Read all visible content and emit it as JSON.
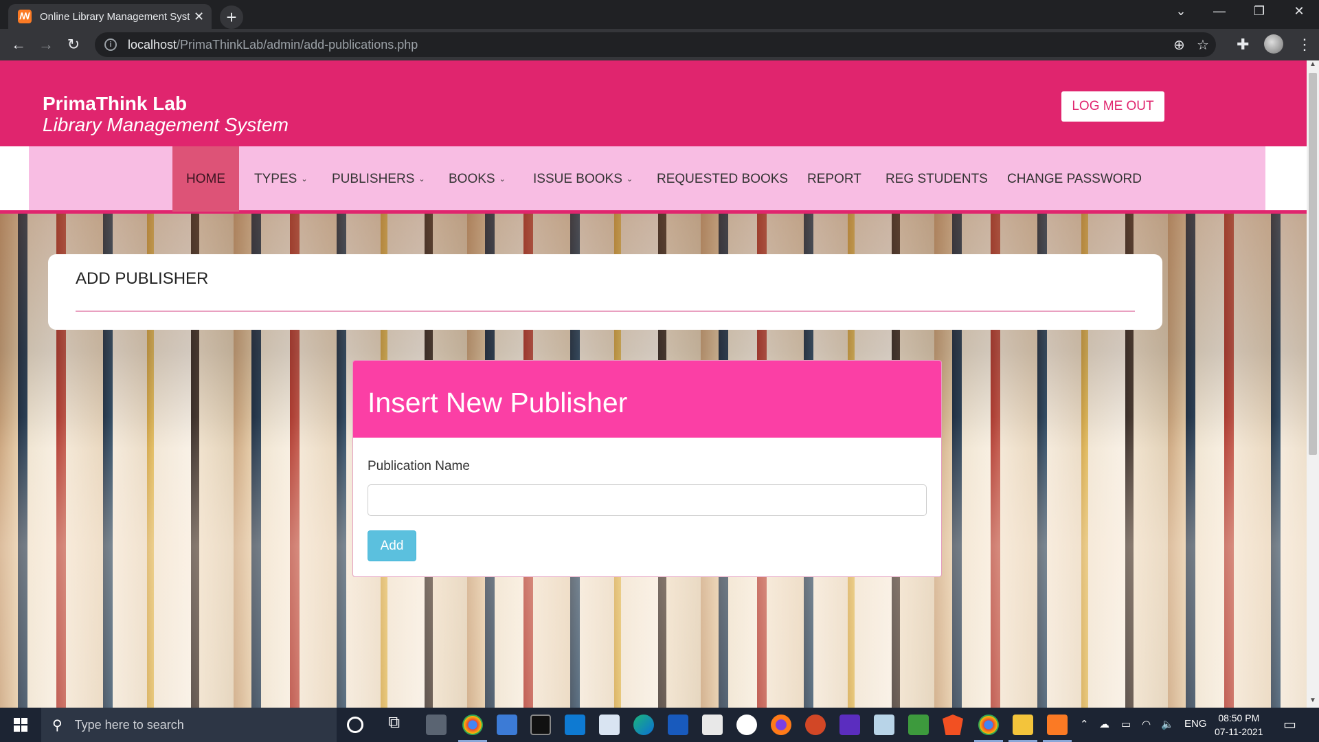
{
  "browser": {
    "tab_title": "Online Library Management System",
    "favicon_glyph": "ꟿ",
    "new_tab": "+",
    "url_host": "localhost",
    "url_path": "/PrimaThinkLab/admin/add-publications.php"
  },
  "header": {
    "brand_title": "PrimaThink Lab",
    "brand_subtitle": "Library Management System",
    "logout_label": "LOG ME OUT"
  },
  "nav": {
    "items": [
      {
        "label": "HOME",
        "active": true
      },
      {
        "label": "TYPES",
        "dropdown": true
      },
      {
        "label": "PUBLISHERS",
        "dropdown": true
      },
      {
        "label": "BOOKS",
        "dropdown": true
      },
      {
        "label": "ISSUE BOOKS",
        "dropdown": true
      },
      {
        "label": "REQUESTED BOOKS"
      },
      {
        "label": "REPORT"
      },
      {
        "label": "REG STUDENTS"
      },
      {
        "label": "CHANGE PASSWORD"
      }
    ],
    "caret": "⌄"
  },
  "page": {
    "heading": "ADD PUBLISHER"
  },
  "form": {
    "panel_title": "Insert New Publisher",
    "field_label": "Publication Name",
    "field_value": "",
    "submit_label": "Add"
  },
  "taskbar": {
    "search_placeholder": "Type here to search",
    "language": "ENG",
    "time": "08:50 PM",
    "date": "07-11-2021"
  },
  "colors": {
    "brand_pink": "#e0256e",
    "nav_pink": "#f8bde3",
    "panel_head_pink": "#fb3fa5",
    "button_info": "#5bc0de"
  }
}
